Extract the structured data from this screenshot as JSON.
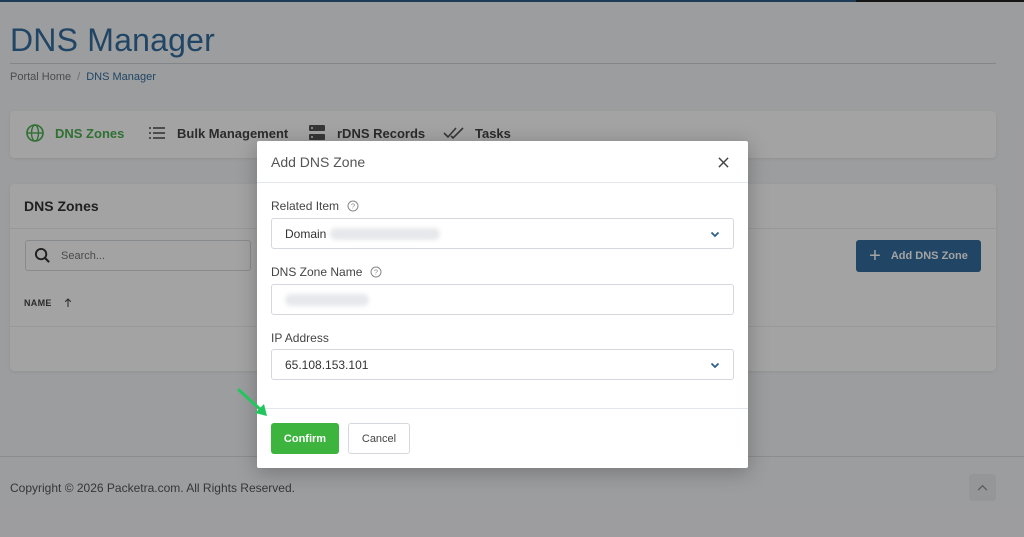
{
  "page": {
    "title": "DNS Manager",
    "breadcrumb": [
      "Portal Home",
      "DNS Manager"
    ]
  },
  "nav": {
    "items": [
      {
        "label": "DNS Zones",
        "icon": "globe-icon",
        "active": true
      },
      {
        "label": "Bulk Management",
        "icon": "list-icon",
        "active": false
      },
      {
        "label": "rDNS Records",
        "icon": "server-icon",
        "active": false
      },
      {
        "label": "Tasks",
        "icon": "double-check-icon",
        "active": false
      }
    ]
  },
  "zones": {
    "title": "DNS Zones",
    "search_placeholder": "Search...",
    "column_name": "NAME",
    "add_button": "Add DNS Zone"
  },
  "modal": {
    "title": "Add DNS Zone",
    "fields": {
      "related_item": {
        "label": "Related Item",
        "value": "Domain"
      },
      "zone_name": {
        "label": "DNS Zone Name",
        "value": ""
      },
      "ip_address": {
        "label": "IP Address",
        "value": "65.108.153.101"
      }
    },
    "confirm_label": "Confirm",
    "cancel_label": "Cancel"
  },
  "footer": {
    "copyright": "Copyright © 2026 Packetra.com. All Rights Reserved."
  },
  "colors": {
    "brand_blue": "#336c9e",
    "active_green": "#4caf50",
    "confirm_green": "#3cb43e",
    "arrow_green": "#22c55e"
  }
}
